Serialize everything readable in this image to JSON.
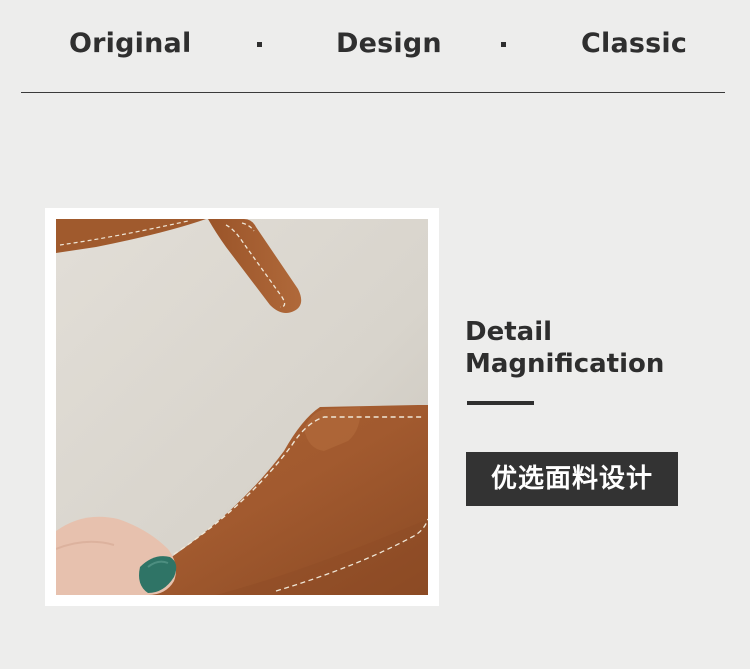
{
  "header": {
    "words": [
      "Original",
      "Design",
      "Classic"
    ],
    "separator": "·"
  },
  "detail": {
    "title_line1": "Detail",
    "title_line2": "Magnification",
    "tag": "优选面料设计"
  },
  "photo": {
    "subject": "leather-card-holder",
    "colors": {
      "background": "#d8d4cc",
      "leather": "#a25a2f",
      "leather_dark": "#7e4220",
      "stitch": "#efe6d6",
      "nail": "#2f7466",
      "skin": "#e8c2b0"
    }
  },
  "colors": {
    "page_background": "#ededec",
    "text": "#2f2f2f",
    "tag_background": "#333333",
    "tag_text": "#ffffff"
  }
}
